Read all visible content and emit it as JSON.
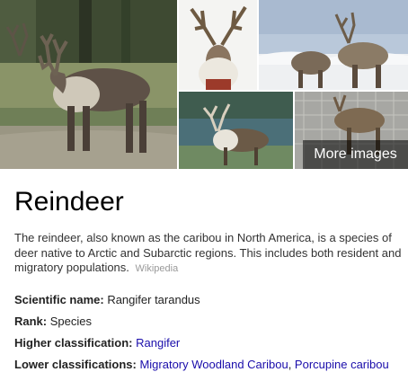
{
  "images": {
    "tiles": [
      {
        "subject": "reindeer-standing-in-grass-field"
      },
      {
        "subject": "reindeer-head-with-antlers"
      },
      {
        "subject": "reindeer-pair-in-snow"
      },
      {
        "subject": "caribou-by-lake"
      },
      {
        "subject": "reindeer-in-enclosure"
      }
    ],
    "more_label": "More images"
  },
  "entity": {
    "title": "Reindeer",
    "description": "The reindeer, also known as the caribou in North America, is a species of deer native to Arctic and Subarctic regions. This includes both resident and migratory populations.",
    "source": "Wikipedia"
  },
  "facts": {
    "scientific_name": {
      "label": "Scientific name:",
      "value": " Rangifer tarandus"
    },
    "rank": {
      "label": "Rank:",
      "value": " Species"
    },
    "higher": {
      "label": "Higher classification:",
      "value": "Rangifer"
    },
    "lower": {
      "label": "Lower classifications:",
      "link1": "Migratory Woodland Caribou",
      "sep": ", ",
      "link2": "Porcupine caribou"
    }
  },
  "colors": {
    "link": "#1a0dab",
    "source": "#999999",
    "overlay": "rgba(0,0,0,0.55)"
  }
}
